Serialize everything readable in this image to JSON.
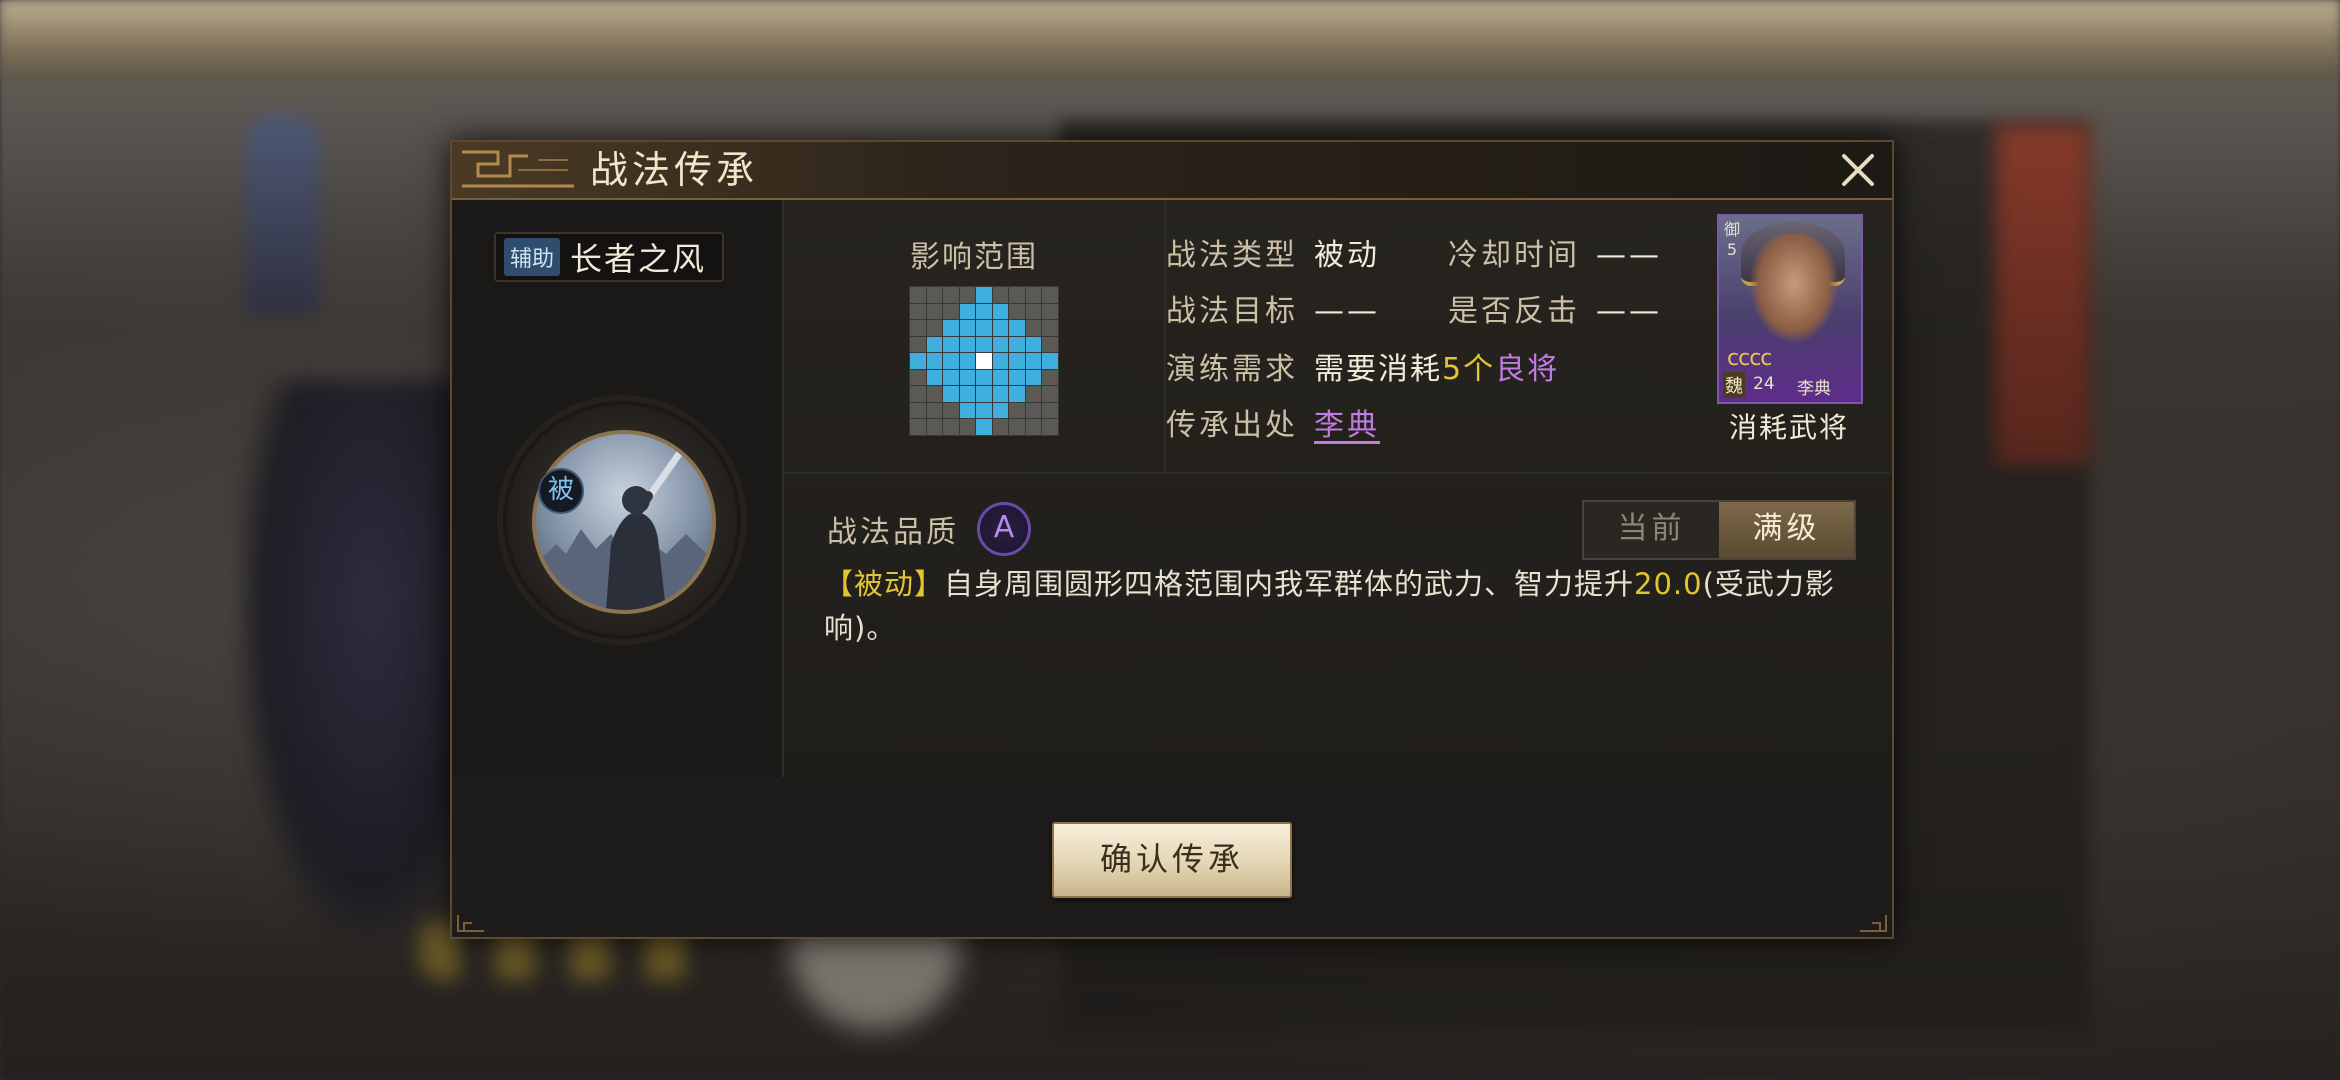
{
  "dialog": {
    "title": "战法传承",
    "close_icon": "close-icon"
  },
  "skill": {
    "category": "辅助",
    "name": "长者之风",
    "type_badge": "被",
    "icon": "sword-warrior-icon"
  },
  "range": {
    "title": "影响范围",
    "grid_size": 9,
    "radius": 4
  },
  "info": {
    "type_label": "战法类型",
    "type_value": "被动",
    "cooldown_label": "冷却时间",
    "cooldown_value": "——",
    "target_label": "战法目标",
    "target_value": "——",
    "counter_label": "是否反击",
    "counter_value": "——",
    "drill_label": "演练需求",
    "drill_value_prefix": "需要消耗",
    "drill_value_count": "5个",
    "drill_value_quality": "良将",
    "source_label": "传承出处",
    "source_value": "李典"
  },
  "hero_card": {
    "side_text": "御",
    "side_num": "5",
    "stars": "cccc",
    "faction": "魏",
    "level": "24",
    "name": "李典",
    "caption": "消耗武将"
  },
  "quality": {
    "label": "战法品质",
    "grade": "A"
  },
  "toggle": {
    "options": [
      "当前",
      "满级"
    ],
    "active_index": 1
  },
  "description": {
    "tag": "【被动】",
    "text_before": "自身周围圆形四格范围内我军群体的武力、智力提升",
    "value": "20.0",
    "text_after": "(受武力影响)。"
  },
  "confirm_button": "确认传承",
  "colors": {
    "range_active": "#3fb0dd",
    "highlight_yellow": "#e2c530",
    "quality_purple": "#c07be0"
  }
}
